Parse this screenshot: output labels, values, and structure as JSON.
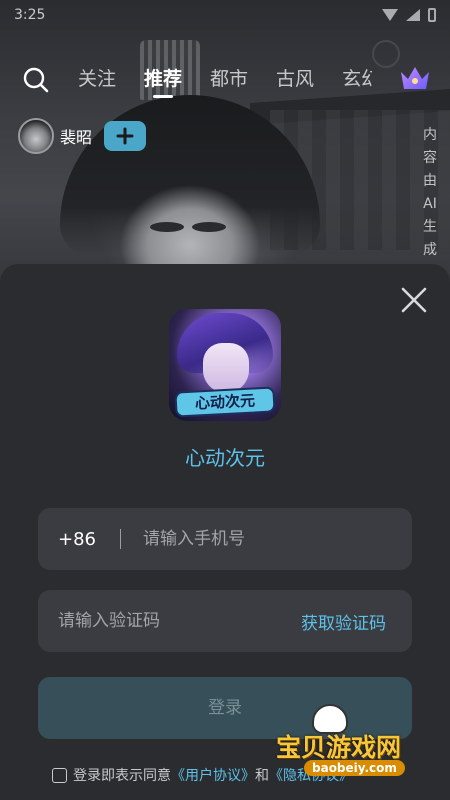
{
  "status_bar": {
    "time": "3:25"
  },
  "nav": {
    "tabs": [
      {
        "label": "关注",
        "active": false
      },
      {
        "label": "推荐",
        "active": true
      },
      {
        "label": "都市",
        "active": false
      },
      {
        "label": "古风",
        "active": false
      },
      {
        "label": "玄幻",
        "active": false
      }
    ],
    "icons": {
      "search": "search-icon",
      "vip": "crown-icon"
    }
  },
  "character": {
    "name": "裴昭"
  },
  "ai_note": "内容由AI生成",
  "login": {
    "app_logo_text": "心动次元",
    "app_name": "心动次元",
    "country_code": "+86",
    "phone_placeholder": "请输入手机号",
    "code_placeholder": "请输入验证码",
    "get_code_label": "获取验证码",
    "login_label": "登录",
    "agreement_prefix": "登录即表示同意",
    "user_agreement": "《用户协议》",
    "agreement_joiner": "和",
    "privacy_policy": "《隐私协议》"
  },
  "watermark": {
    "name": "宝贝游戏网",
    "url": "baobeiy.com"
  },
  "colors": {
    "accent": "#5cc2ea",
    "sheet_bg": "#2b2c30",
    "field_bg": "#3b3c41",
    "login_button_bg": "#364f58",
    "follow_button_bg": "#4aa7c9"
  }
}
